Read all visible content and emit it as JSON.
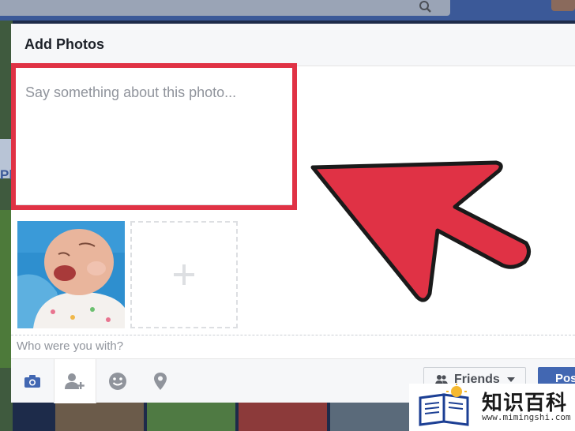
{
  "dialog": {
    "title": "Add Photos",
    "caption_placeholder": "Say something about this photo...",
    "tag_prompt": "Who were you with?"
  },
  "footer": {
    "tools": [
      "camera-icon",
      "tag-friends-icon",
      "feeling-icon",
      "location-icon"
    ],
    "audience_label": "Friends",
    "post_label": "Post"
  },
  "background": {
    "left_fragment": "Ph"
  },
  "watermark": {
    "brand": "知识百科",
    "url": "www.mimingshi.com"
  },
  "colors": {
    "facebook_blue": "#3b5998",
    "post_button": "#4267b2",
    "highlight_red": "#e03245"
  }
}
